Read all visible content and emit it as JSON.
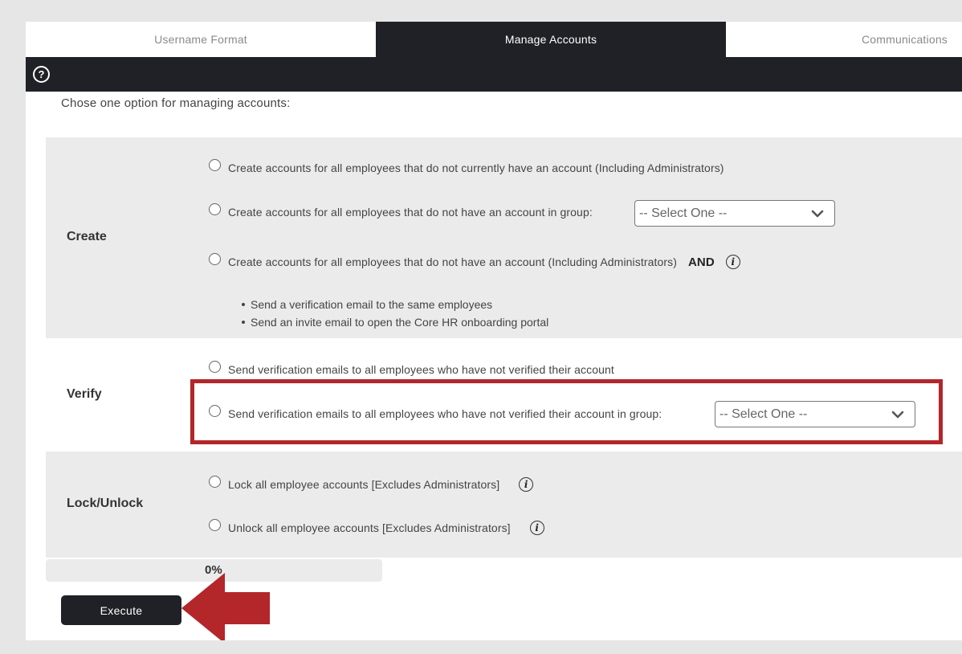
{
  "tabs": [
    {
      "label": "Username Format",
      "active": false
    },
    {
      "label": "Manage Accounts",
      "active": true
    },
    {
      "label": "Communications",
      "active": false
    }
  ],
  "help_icon": "question-circle-icon",
  "intro": "Chose one option for managing accounts:",
  "create": {
    "label": "Create",
    "option1": "Create accounts for all employees that do not currently have an account (Including Administrators)",
    "option2": "Create accounts for all employees that do not have an account in group:",
    "option2_select": "-- Select One --",
    "option3": "Create accounts for all employees that do not have an account (Including Administrators)",
    "option3_and": "AND",
    "option3_bullets": [
      "Send a verification email to the same employees",
      "Send an invite email to open the Core HR onboarding portal"
    ]
  },
  "verify": {
    "label": "Verify",
    "option1": "Send verification emails to all employees who have not verified their account",
    "option2": "Send verification emails to all employees who have not verified their account in group:",
    "option2_select": "-- Select One --"
  },
  "lock": {
    "label": "Lock/Unlock",
    "option1": "Lock all employee accounts [Excludes Administrators]",
    "option2": "Unlock all employee accounts [Excludes Administrators]"
  },
  "progress": {
    "label": "0%",
    "value": 0
  },
  "execute_label": "Execute",
  "colors": {
    "dark": "#1f2126",
    "highlight": "#b3262a",
    "section_bg": "#ebebeb"
  }
}
